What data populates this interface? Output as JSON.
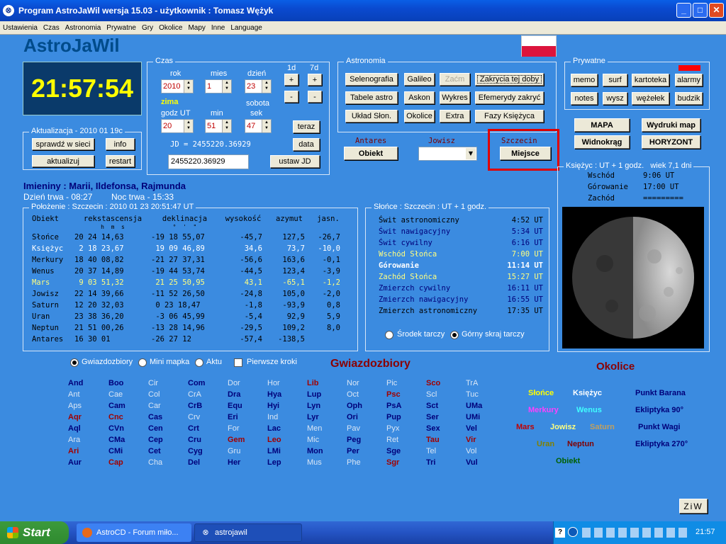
{
  "window": {
    "title": "Program AstroJaWil wersja 15.03 - użytkownik : Tomasz Wężyk",
    "min": "_",
    "max": "□",
    "close": "✕"
  },
  "menu": [
    "Ustawienia",
    "Czas",
    "Astronomia",
    "Prywatne",
    "Gry",
    "Okolice",
    "Mapy",
    "Inne",
    "Language"
  ],
  "app": {
    "name": "AstroJaWil",
    "clock": "21:57:54"
  },
  "czas": {
    "legend": "Czas",
    "rok_label": "rok",
    "mies_label": "mies",
    "dzien_label": "dzień",
    "rok": "2010",
    "mies": "1",
    "dzien": "23",
    "sezon": "zima",
    "dzien_tyg": "sobota",
    "godz_label": "godz UT",
    "min_label": "min",
    "sek_label": "sek",
    "godz": "20",
    "min": "51",
    "sek": "47",
    "d1": "1d",
    "d7": "7d",
    "plus": "+",
    "minus": "-",
    "teraz": "teraz",
    "data": "data",
    "jd_text": "JD = 2455220.36929",
    "jd_input": "2455220.36929",
    "ustaw_jd": "ustaw JD"
  },
  "aktualizacja": {
    "legend": "Aktualizacja - 2010 01 19c",
    "sprawdz": "sprawdź w sieci",
    "info": "info",
    "aktualizuj": "aktualizuj",
    "restart": "restart"
  },
  "astronomia": {
    "legend": "Astronomia",
    "buttons": [
      "Selenografia",
      "Galileo",
      "Zaćm",
      "Zakrycia tej doby",
      "Tabele astro",
      "Askon",
      "Wykres",
      "Efemerydy zakryć",
      "Układ Słon.",
      "Okolice",
      "Extra",
      "Fazy Księżyca"
    ]
  },
  "prywatne": {
    "legend": "Prywatne",
    "buttons": [
      "memo",
      "surf",
      "kartoteka",
      "alarmy",
      "notes",
      "wysz",
      "wężełek",
      "budzik"
    ]
  },
  "maps": {
    "mapa": "MAPA",
    "wydruki": "Wydruki map",
    "widnokrag": "Widnokrąg",
    "horyzont": "HORYZONT"
  },
  "objects": {
    "antares": "Antares",
    "obiekt": "Obiekt",
    "jowisz": "Jowisz",
    "szczecin": "Szczecin",
    "miejsce": "Miejsce"
  },
  "imieniny": {
    "text": "Imieniny : Marii, Ildefonsa, Rajmunda",
    "dzien": "Dzień trwa - 08:27",
    "noc": "Noc trwa - 15:33"
  },
  "polozenie": {
    "legend": "Położenie : Szczecin : 2010 01 23   20:51:47 UT",
    "headers": [
      "Obiekt",
      "rekstascensja",
      "deklinacja",
      "wysokość",
      "azymut",
      "jasn."
    ],
    "subheaders": [
      "h  m  s",
      "°  '  \""
    ],
    "rows": [
      [
        "Słońce",
        "20 24 14,63",
        "-19 18 55,07",
        "-45,7",
        "127,5",
        "-26,7"
      ],
      [
        "Księżyc",
        " 2 18 23,67",
        " 19 09 46,89",
        "34,6",
        "73,7",
        "-10,0"
      ],
      [
        "Merkury",
        "18 40 08,82",
        "-21 27 37,31",
        "-56,6",
        "163,6",
        "-0,1"
      ],
      [
        "Wenus",
        "20 37 14,89",
        "-19 44 53,74",
        "-44,5",
        "123,4",
        "-3,9"
      ],
      [
        "Mars",
        " 9 03 51,32",
        " 21 25 50,95",
        "43,1",
        "-65,1",
        "-1,2"
      ],
      [
        "Jowisz",
        "22 14 39,66",
        "-11 52 26,50",
        "-24,8",
        "105,0",
        "-2,0"
      ],
      [
        "Saturn",
        "12 20 32,03",
        " 0 23 18,47",
        "-1,8",
        "-93,9",
        "0,8"
      ],
      [
        "Uran",
        "23 38 36,20",
        " -3 06 45,99",
        "-5,4",
        "92,9",
        "5,9"
      ],
      [
        "Neptun",
        "21 51 00,26",
        "-13 28 14,96",
        "-29,5",
        "109,2",
        "8,0"
      ],
      [
        "Antares",
        "16 30 01",
        "-26 27 12",
        "-57,4",
        "-138,5",
        ""
      ]
    ]
  },
  "slonce": {
    "legend": "Słońce : Szczecin : UT + 1 godz.",
    "rows": [
      [
        "Świt astronomiczny",
        "4:52 UT"
      ],
      [
        "Świt nawigacyjny",
        "5:34 UT"
      ],
      [
        "Świt cywilny",
        "6:16 UT"
      ],
      [
        "Wschód Słońca",
        "7:00 UT"
      ],
      [
        "Górowanie",
        "11:14 UT"
      ],
      [
        "Zachód Słońca",
        "15:27 UT"
      ],
      [
        "Zmierzch cywilny",
        "16:11 UT"
      ],
      [
        "Zmierzch nawigacyjny",
        "16:55 UT"
      ],
      [
        "Zmierzch astronomiczny",
        "17:35 UT"
      ]
    ],
    "radio1": "Środek tarczy",
    "radio2": "Górny skraj tarczy"
  },
  "ksiezyc": {
    "legend": "Księżyc : UT + 1 godz.   wiek 7,1 dni",
    "rows": [
      [
        "Wschód",
        "9:06 UT"
      ],
      [
        "Górowanie",
        "17:00 UT"
      ],
      [
        "Zachód",
        "========="
      ]
    ]
  },
  "bottom": {
    "radios": [
      "Gwiazdozbiory",
      "Mini mapka",
      "Aktu"
    ],
    "check": "Pierwsze kroki",
    "gwiazdozbiory_title": "Gwiazdozbiory",
    "okolice_title": "Okolice",
    "ziw": "ZiW"
  },
  "constellations": [
    [
      "And",
      "Ant",
      "Aps",
      "Aqr",
      "Aql",
      "Ara",
      "Ari",
      "Aur"
    ],
    [
      "Boo",
      "Cae",
      "Cam",
      "Cnc",
      "CVn",
      "CMa",
      "CMi",
      "Cap"
    ],
    [
      "Cir",
      "Col",
      "Car",
      "Cas",
      "Cen",
      "Cep",
      "Cet",
      "Cha"
    ],
    [
      "Com",
      "CrA",
      "CrB",
      "Crv",
      "Crt",
      "Cru",
      "Cyg",
      "Del"
    ],
    [
      "Dor",
      "Dra",
      "Equ",
      "Eri",
      "For",
      "Gem",
      "Gru",
      "Her"
    ],
    [
      "Hor",
      "Hya",
      "Hyi",
      "Ind",
      "Lac",
      "Leo",
      "LMi",
      "Lep"
    ],
    [
      "Lib",
      "Lup",
      "Lyn",
      "Lyr",
      "Men",
      "Mic",
      "Mon",
      "Mus"
    ],
    [
      "Nor",
      "Oct",
      "Oph",
      "Ori",
      "Pav",
      "Peg",
      "Per",
      "Phe"
    ],
    [
      "Pic",
      "Psc",
      "PsA",
      "Pup",
      "Pyx",
      "Ret",
      "Sge",
      "Sgr"
    ],
    [
      "Sco",
      "Scl",
      "Sct",
      "Ser",
      "Sex",
      "Tau",
      "Tel",
      "Tri"
    ],
    [
      "TrA",
      "Tuc",
      "UMa",
      "UMi",
      "Vel",
      "Vir",
      "Vol",
      "Vul"
    ]
  ],
  "okolice": {
    "items": [
      [
        "Słońce",
        "#ffff00"
      ],
      [
        "Księżyc",
        "#ffffff"
      ],
      [
        "Punkt Barana",
        "#00007a"
      ],
      [
        "Merkury",
        "#ff40ff"
      ],
      [
        "Wenus",
        "#40ffff"
      ],
      [
        "Ekliptyka 90°",
        "#00007a"
      ],
      [
        "Mars",
        "#c00000"
      ],
      [
        "Jowisz",
        "#ffff80"
      ],
      [
        "Saturn",
        "#c0a060"
      ],
      [
        "Punkt Wagi",
        "#00007a"
      ],
      [
        "Uran",
        "#808000"
      ],
      [
        "Neptun",
        "#800000"
      ],
      [
        "Ekliptyka 270°",
        "#00007a"
      ],
      [
        "Obiekt",
        "#006000"
      ]
    ]
  },
  "taskbar": {
    "start": "Start",
    "task1": "AstroCD - Forum miło...",
    "task2": "astrojawil",
    "time": "21:57",
    "help": "?"
  }
}
